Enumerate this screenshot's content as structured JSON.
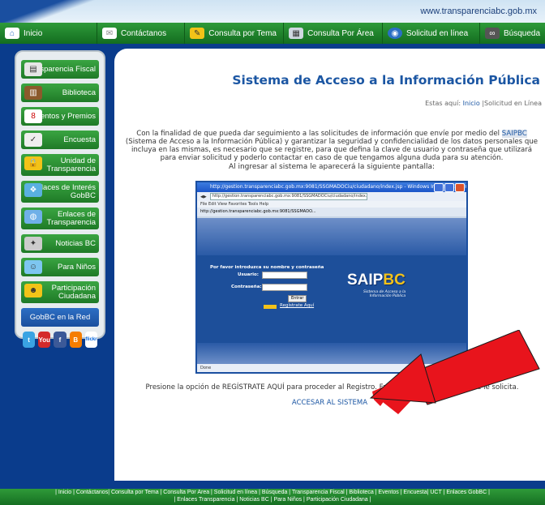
{
  "header": {
    "url_text": "www.transparenciabc.gob.mx"
  },
  "nav": [
    {
      "label": "Inicio",
      "icon": "home-icon"
    },
    {
      "label": "Contáctanos",
      "icon": "envelope-icon"
    },
    {
      "label": "Consulta por Tema",
      "icon": "pencil-icon"
    },
    {
      "label": "Consulta Por Área",
      "icon": "grid-icon"
    },
    {
      "label": "Solicitud en línea",
      "icon": "globe-icon"
    },
    {
      "label": "Búsqueda",
      "icon": "binoculars-icon"
    }
  ],
  "sidebar": {
    "items": [
      {
        "label": "Transparencia Fiscal",
        "icon": "calculator-icon"
      },
      {
        "label": "Biblioteca",
        "icon": "books-icon"
      },
      {
        "label": "Eventos y Premios",
        "icon": "calendar-icon"
      },
      {
        "label": "Encuesta",
        "icon": "clipboard-icon"
      },
      {
        "label": "Unidad de Transparencia",
        "icon": "lock-icon"
      },
      {
        "label": "Enlaces de Interés GobBC",
        "icon": "network-icon"
      },
      {
        "label": "Enlaces de Transparencia",
        "icon": "globe-link-icon"
      },
      {
        "label": "Noticias BC",
        "icon": "satellite-icon"
      },
      {
        "label": "Para Niños",
        "icon": "kids-icon"
      },
      {
        "label": "Participación Ciudadana",
        "icon": "people-icon"
      }
    ],
    "red_label": "GobBC en la Red",
    "social": [
      {
        "text": "t",
        "name": "twitter-icon",
        "color": "#3aa3e3"
      },
      {
        "text": "You",
        "name": "youtube-icon",
        "color": "#d42a2a"
      },
      {
        "text": "f",
        "name": "facebook-icon",
        "color": "#3b5998"
      },
      {
        "text": "B",
        "name": "blogger-icon",
        "color": "#f57d00"
      },
      {
        "text": "flickr",
        "name": "flickr-icon",
        "color": "#ffffff"
      }
    ]
  },
  "main": {
    "title": "Sistema de Acceso a la Información Pública",
    "breadcrumb_prefix": "Estas aquí:",
    "breadcrumb_home": "Inicio",
    "breadcrumb_sep": "|",
    "breadcrumb_current": "Solicitud en Línea",
    "intro_a": "Con la finalidad de que pueda dar seguimiento a las solicitudes de información que envíe por medio del ",
    "intro_saipbc": "SAIPBC",
    "intro_b": " (Sistema de Acceso a la Información Pública) y garantizar la seguridad y confidencialidad de los datos personales que incluya en las mismas, es necesario que se registre, para que defina la clave de usuario y contraseña que utilizará para enviar solicitud y poderlo contactar en caso de que tengamos alguna duda para su atención.",
    "intro2": "Al ingresar al sistema le aparecerá la siguiente pantalla:",
    "after_text": "Presione la opción de REGÍSTRATE AQUÍ para proceder al Registro. Favor de pr                    formación que se le solicita.",
    "accesar_label": "ACCESAR AL SISTEMA"
  },
  "embedded_screenshot": {
    "window_title": "http://gestion.transparenciabc.gob.mx:9081/SSGMADOCiu/ciudadano/index.jsp - Windows Internet Explorer",
    "address": "http://gestion.transparenciabc.gob.mx:9081/SSGMADOCiu/ciudadano/index.jsp",
    "menu": "File  Edit  View  Favorites  Tools  Help",
    "tab": "http://gestion.transparenciabc.gob.mx:9081/SSGMADO...",
    "login_title": "Por favor introduzca su nombre y contraseña",
    "user_label": "Usuario:",
    "pass_label": "Contraseña:",
    "enter_label": "Entrar",
    "register_label": "Regístrate Aquí",
    "logo_saip": "SAIP",
    "logo_bc": "BC",
    "logo_sub1": "Sistema de Acceso a la",
    "logo_sub2": "Información Pública",
    "status": "Done"
  },
  "footer": {
    "line1": "| Inicio | Contáctanos| Consulta por Tema | Consulta Por Area | Solicitud en línea | Búsqueda | Transparencia Fiscal | Biblioteca | Eventos | Encuesta| UCT | Enlaces GobBC |",
    "line2": "| Enlaces Transparencia | Noticias BC | Para Niños | Participación Ciudadana |"
  },
  "colors": {
    "nav_green": "#1f7a27",
    "title_blue": "#1b56a3",
    "arrow_red": "#e8141c"
  }
}
